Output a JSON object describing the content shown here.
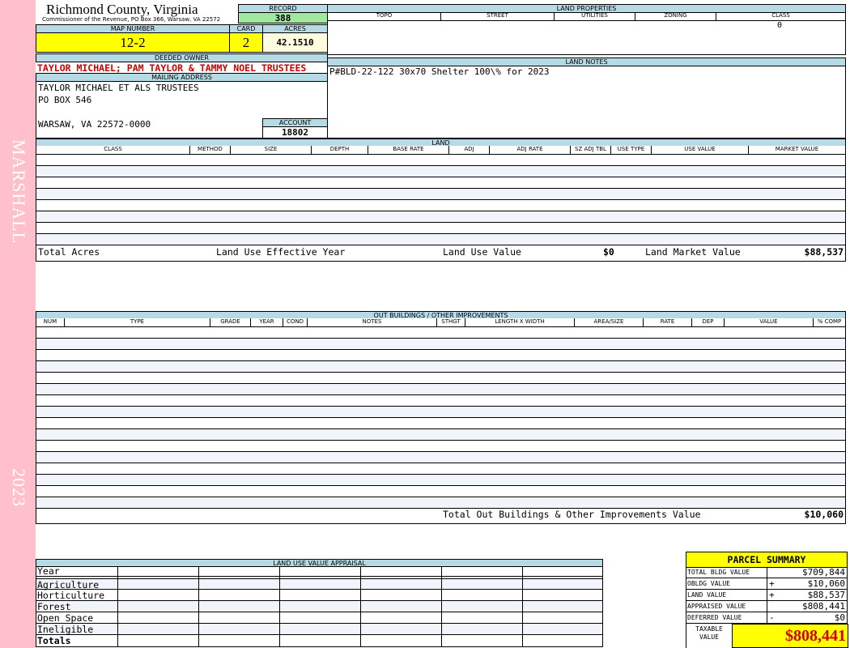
{
  "sidebar": {
    "owner_vertical": "MARSHALL",
    "year_vertical": "2023"
  },
  "header": {
    "county": "Richmond County, Virginia",
    "commissioner": "Commissioner of the Revenue, PO Box 366, Warsaw, VA 22572"
  },
  "record": {
    "label": "RECORD",
    "value": "388"
  },
  "map": {
    "label": "MAP NUMBER",
    "value": "12-2"
  },
  "card": {
    "label": "CARD",
    "value": "2"
  },
  "acres": {
    "label": "ACRES",
    "value": "42.1510"
  },
  "owner": {
    "label": "DEEDED OWNER",
    "value": "TAYLOR MICHAEL; PAM TAYLOR & TAMMY NOEL TRUSTEES"
  },
  "mailing": {
    "label": "MAILING ADDRESS",
    "line1": "TAYLOR MICHAEL ET ALS TRUSTEES",
    "line2": "PO BOX 546",
    "line3": "WARSAW, VA 22572-0000"
  },
  "account": {
    "label": "ACCOUNT",
    "value": "18802"
  },
  "land_properties": {
    "title": "LAND PROPERTIES",
    "columns": [
      "TOPO",
      "STREET",
      "UTILITIES",
      "ZONING",
      "CLASS"
    ],
    "class_value": "0"
  },
  "land_notes": {
    "title": "LAND NOTES",
    "text": "P#BLD-22-122 30x70 Shelter 100\\% for 2023"
  },
  "land": {
    "title": "LAND",
    "columns": [
      "CLASS",
      "METHOD",
      "SIZE",
      "DEPTH",
      "BASE RATE",
      "ADJ",
      "ADJ RATE",
      "SZ ADJ TBL",
      "USE TYPE",
      "USE VALUE",
      "MARKET VALUE"
    ],
    "footer": {
      "total_acres": "Total Acres",
      "effective_year": "Land Use Effective Year",
      "use_value_label": "Land Use Value",
      "use_value": "$0",
      "market_label": "Land Market Value",
      "market_value": "$88,537"
    }
  },
  "outbuildings": {
    "title": "OUT BUILDINGS / OTHER IMPROVEMENTS",
    "columns": [
      "NUM",
      "TYPE",
      "GRADE",
      "YEAR",
      "COND",
      "NOTES",
      "STHGT",
      "LENGTH X WIDTH",
      "AREA/SIZE",
      "RATE",
      "DEP",
      "VALUE",
      "% COMP"
    ],
    "total_label": "Total Out Buildings & Other Improvements Value",
    "total_value": "$10,060"
  },
  "land_use": {
    "title": "LAND USE VALUE APPRAISAL",
    "rows": [
      "Year",
      "Agriculture",
      "Horticulture",
      "Forest",
      "Open Space",
      "Ineligible",
      "Totals"
    ]
  },
  "summary": {
    "title": "PARCEL SUMMARY",
    "rows": [
      {
        "label": "TOTAL BLDG VALUE",
        "sign": "",
        "value": "$709,844"
      },
      {
        "label": "OBLDG VALUE",
        "sign": "+",
        "value": "$10,060"
      },
      {
        "label": "LAND VALUE",
        "sign": "+",
        "value": "$88,537"
      },
      {
        "label": "APPRAISED VALUE",
        "sign": "",
        "value": "$808,441"
      },
      {
        "label": "DEFERRED VALUE",
        "sign": "-",
        "value": "$0"
      }
    ],
    "taxable_label": "TAXABLE VALUE",
    "taxable_value": "$808,441"
  }
}
